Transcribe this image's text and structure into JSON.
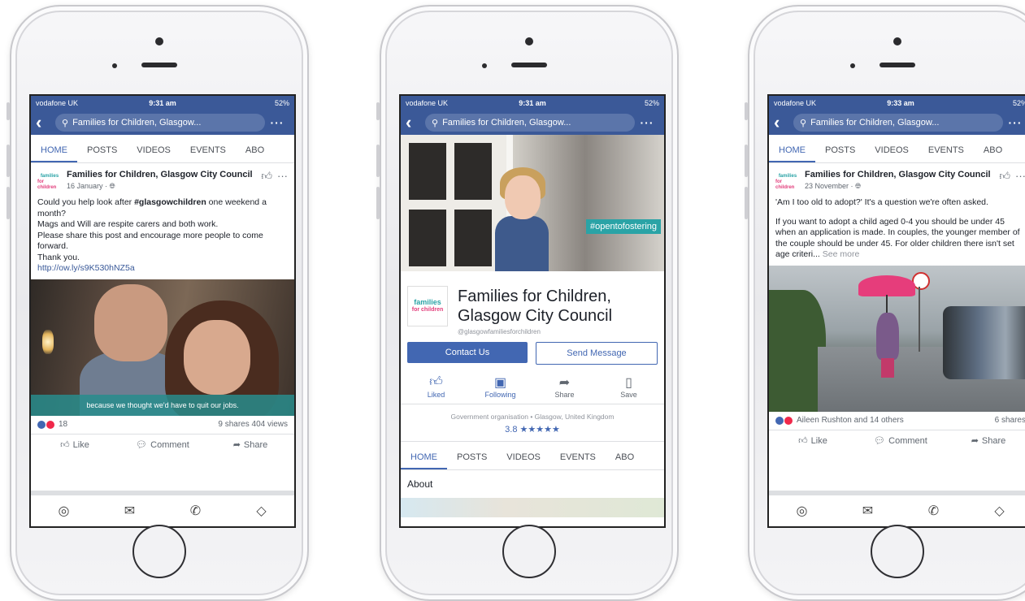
{
  "status": {
    "carrier": "vodafone UK",
    "battery": "52%",
    "times": [
      "9:31 am",
      "9:31 am",
      "9:33 am"
    ]
  },
  "search": {
    "text": "Families for Children, Glasgow..."
  },
  "tabs": [
    "HOME",
    "POSTS",
    "VIDEOS",
    "EVENTS",
    "ABO"
  ],
  "actions": {
    "like": "Like",
    "comment": "Comment",
    "share": "Share"
  },
  "page": {
    "name": "Families for Children, Glasgow City Council",
    "logo_line1": "families",
    "logo_line2": "for children"
  },
  "post1": {
    "date": "16 January · ",
    "text_a": "Could you help look after ",
    "hashtag": "#glasgowchildren",
    "text_b": " one weekend a month?",
    "line2": "Mags and Will are respite carers and both work.",
    "line3": "Please share this post and encourage more people to come forward.",
    "line4": "Thank you.",
    "link": "http://ow.ly/s9K530hNZ5a",
    "video_caption": "because we thought we'd have to quit our jobs.",
    "reaction_count": "18",
    "shares_views": "9 shares  404 views"
  },
  "profile": {
    "cover_hashtag": "#opentofostering",
    "name_line1": "Families for Children,",
    "name_line2": "Glasgow City Council",
    "handle": "@glasgowfamiliesforchildren",
    "cta_primary": "Contact Us",
    "cta_secondary": "Send Message",
    "icons": [
      {
        "label": "Liked",
        "icon": "thumbs-up-icon"
      },
      {
        "label": "Following",
        "icon": "following-icon"
      },
      {
        "label": "Share",
        "icon": "share-icon"
      },
      {
        "label": "Save",
        "icon": "bookmark-icon"
      }
    ],
    "meta": "Government organisation • Glasgow, United Kingdom",
    "rating": "3.8 ★★★★★",
    "about": "About"
  },
  "post3": {
    "date": "23 November · ",
    "line1": "'Am I too old to adopt?' It's a question we're often asked.",
    "line2": "If you want to adopt a child aged 0-4 you should be under 45 when an application is made. In couples, the younger member of the couple should be under 45. For older children there isn't set age criteri...",
    "see_more": "See more",
    "reactions": "Aileen Rushton and 14 others",
    "shares": "6 shares"
  },
  "colors": {
    "facebook_blue": "#3b5998",
    "accent_blue": "#4267b2",
    "teal": "#2aa3a6",
    "pink": "#e23d7b"
  }
}
